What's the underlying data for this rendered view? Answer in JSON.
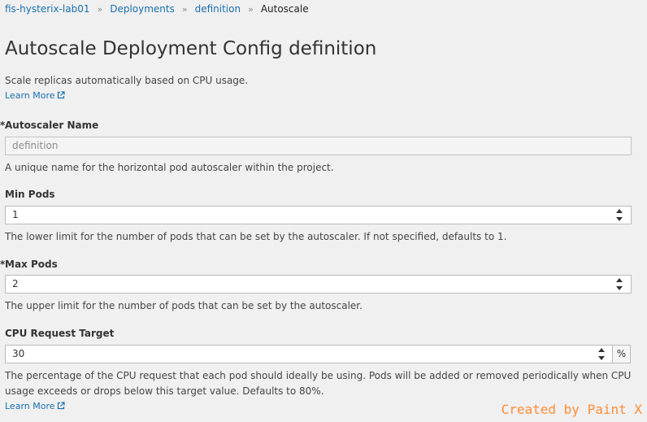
{
  "breadcrumb": {
    "items": [
      "fis-hysterix-lab01",
      "Deployments",
      "definition"
    ],
    "current": "Autoscale",
    "separator": "»"
  },
  "page": {
    "title": "Autoscale Deployment Config definition",
    "description": "Scale replicas automatically based on CPU usage.",
    "learn_more": "Learn More"
  },
  "form": {
    "autoscaler_name": {
      "required_mark": "*",
      "label": "Autoscaler Name",
      "value": "definition",
      "help": "A unique name for the horizontal pod autoscaler within the project."
    },
    "min_pods": {
      "label": "Min Pods",
      "value": "1",
      "help": "The lower limit for the number of pods that can be set by the autoscaler. If not specified, defaults to 1."
    },
    "max_pods": {
      "required_mark": "*",
      "label": "Max Pods",
      "value": "2",
      "help": "The upper limit for the number of pods that can be set by the autoscaler."
    },
    "cpu_target": {
      "label": "CPU Request Target",
      "value": "30",
      "unit": "%",
      "help": "The percentage of the CPU request that each pod should ideally be using. Pods will be added or removed periodically when CPU usage exceeds or drops below this target value. Defaults to 80%.",
      "learn_more": "Learn More"
    }
  },
  "watermark": "Created by Paint X",
  "colors": {
    "link": "#1a6fb0",
    "background": "#f0f0f0",
    "watermark": "#ff8c33"
  }
}
